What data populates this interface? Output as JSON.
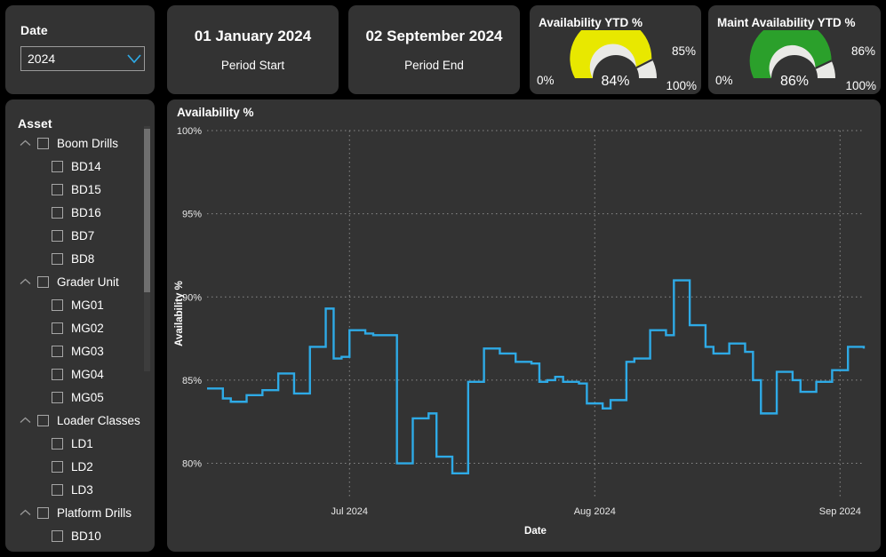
{
  "date_slicer": {
    "title": "Date",
    "value": "2024",
    "chevron_icon": "chevron-down-icon"
  },
  "kpi_cards": [
    {
      "value": "01 January 2024",
      "label": "Period Start"
    },
    {
      "value": "02 September 2024",
      "label": "Period End"
    }
  ],
  "gauges": [
    {
      "title": "Availability YTD %",
      "value": "84%",
      "value_num": 84,
      "min": "0%",
      "max": "100%",
      "target": "85%",
      "target_num": 85,
      "color": "#e8e800"
    },
    {
      "title": "Maint Availability YTD %",
      "value": "86%",
      "value_num": 86,
      "min": "0%",
      "max": "100%",
      "target": "86%",
      "target_num": 86,
      "color": "#2ba02b"
    }
  ],
  "asset_panel": {
    "title": "Asset",
    "items": [
      {
        "label": "Boom Drills",
        "level": "group",
        "expanded": true
      },
      {
        "label": "BD14",
        "level": "child"
      },
      {
        "label": "BD15",
        "level": "child"
      },
      {
        "label": "BD16",
        "level": "child"
      },
      {
        "label": "BD7",
        "level": "child"
      },
      {
        "label": "BD8",
        "level": "child"
      },
      {
        "label": "Grader Unit",
        "level": "group",
        "expanded": true
      },
      {
        "label": "MG01",
        "level": "child"
      },
      {
        "label": "MG02",
        "level": "child"
      },
      {
        "label": "MG03",
        "level": "child"
      },
      {
        "label": "MG04",
        "level": "child"
      },
      {
        "label": "MG05",
        "level": "child"
      },
      {
        "label": "Loader Classes",
        "level": "group",
        "expanded": true
      },
      {
        "label": "LD1",
        "level": "child"
      },
      {
        "label": "LD2",
        "level": "child"
      },
      {
        "label": "LD3",
        "level": "child"
      },
      {
        "label": "Platform Drills",
        "level": "group",
        "expanded": true
      },
      {
        "label": "BD10",
        "level": "child"
      }
    ]
  },
  "chart_data": {
    "type": "line",
    "step": true,
    "title": "Availability %",
    "xlabel": "Date",
    "ylabel": "Availability %",
    "line_color": "#2eaae6",
    "grid": true,
    "ylim": [
      78,
      100
    ],
    "yticks": [
      80,
      85,
      90,
      95,
      100
    ],
    "ytick_labels": [
      "80%",
      "85%",
      "90%",
      "95%",
      "100%"
    ],
    "xticks": [
      18,
      49,
      80
    ],
    "xtick_labels": [
      "Jul 2024",
      "Aug 2024",
      "Sep 2024"
    ],
    "x": [
      0,
      1,
      2,
      3,
      4,
      5,
      6,
      7,
      8,
      9,
      10,
      11,
      12,
      13,
      14,
      15,
      16,
      17,
      18,
      19,
      20,
      21,
      22,
      23,
      24,
      25,
      26,
      27,
      28,
      29,
      30,
      31,
      32,
      33,
      34,
      35,
      36,
      37,
      38,
      39,
      40,
      41,
      42,
      43,
      44,
      45,
      46,
      47,
      48,
      49,
      50,
      51,
      52,
      53,
      54,
      55,
      56,
      57,
      58,
      59,
      60,
      61,
      62,
      63,
      64,
      65,
      66,
      67,
      68,
      69,
      70,
      71,
      72,
      73,
      74,
      75,
      76,
      77,
      78,
      79,
      80,
      81,
      82,
      83
    ],
    "values": [
      84.5,
      84.5,
      83.9,
      83.7,
      83.7,
      84.1,
      84.1,
      84.4,
      84.4,
      85.4,
      85.4,
      84.2,
      84.2,
      87.0,
      87.0,
      89.3,
      86.3,
      86.4,
      88.0,
      88.0,
      87.8,
      87.7,
      87.7,
      87.7,
      80.0,
      80.0,
      82.7,
      82.7,
      83.0,
      80.4,
      80.4,
      79.4,
      79.4,
      84.9,
      84.9,
      86.9,
      86.9,
      86.6,
      86.6,
      86.1,
      86.1,
      86.0,
      84.9,
      85.0,
      85.2,
      84.9,
      84.9,
      84.8,
      83.6,
      83.6,
      83.3,
      83.8,
      83.8,
      86.1,
      86.3,
      86.3,
      88.0,
      88.0,
      87.7,
      91.0,
      91.0,
      88.3,
      88.3,
      87.0,
      86.6,
      86.6,
      87.2,
      87.2,
      86.7,
      85.0,
      83.0,
      83.0,
      85.5,
      85.5,
      85.0,
      84.3,
      84.3,
      84.9,
      84.9,
      85.6,
      85.6,
      87.0,
      87.0,
      86.9
    ],
    "series_name": "Availability %"
  }
}
